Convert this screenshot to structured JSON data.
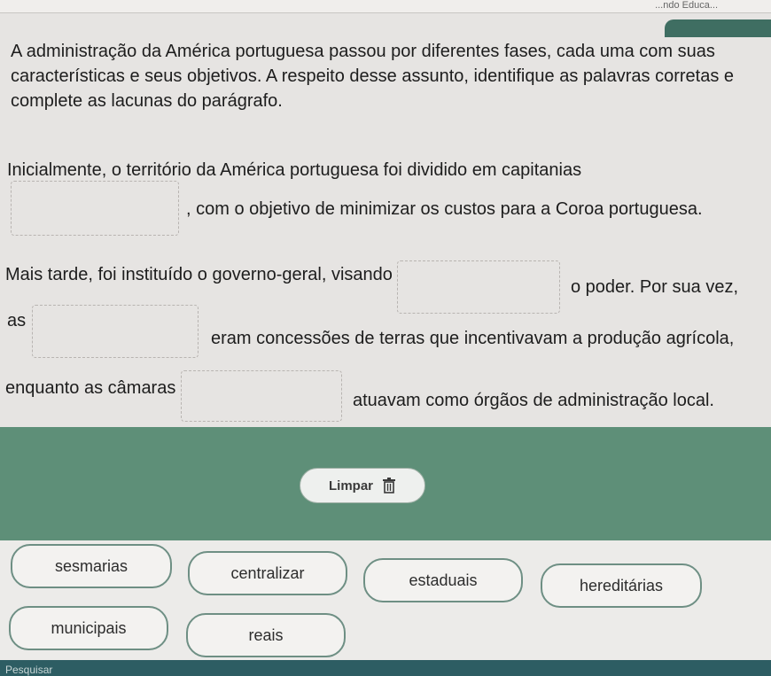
{
  "top_bar": {
    "text": "...ndo Educa..."
  },
  "question": {
    "text": "A administração da América portuguesa passou por diferentes fases, cada uma com suas características e seus objetivos. A respeito desse assunto, identifique as palavras corretas e complete as lacunas do parágrafo."
  },
  "paragraph": {
    "line1": "Inicialmente, o território da América portuguesa foi dividido em capitanias",
    "line2_after": ", com o objetivo de minimizar os custos para a Coroa portuguesa.",
    "line3_before": "Mais tarde, foi instituído o governo-geral, visando",
    "line3_after": "o poder. Por sua vez,",
    "line4_before": "as",
    "line4_after": "eram concessões de terras que incentivavam a produção agrícola,",
    "line5_before": "enquanto as câmaras",
    "line5_after": "atuavam como órgãos de administração local."
  },
  "clear_button": {
    "label": "Limpar",
    "icon": "trash-icon"
  },
  "options": [
    "sesmarias",
    "centralizar",
    "estaduais",
    "hereditárias",
    "municipais",
    "reais"
  ],
  "footer": {
    "text": "Pesquisar"
  },
  "colors": {
    "panel_green": "#5e8f78",
    "chip_border": "#6e8f84",
    "footer": "#2d5d63"
  }
}
